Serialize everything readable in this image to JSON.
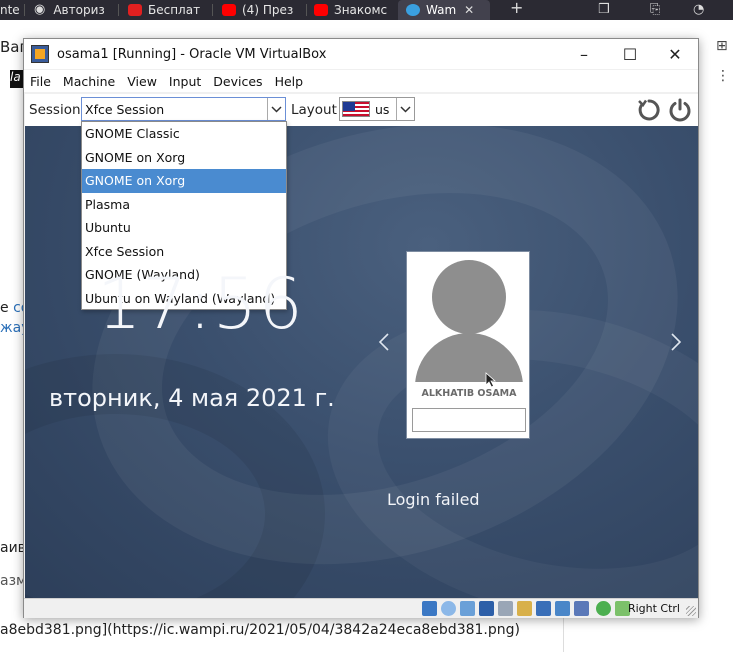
{
  "browser": {
    "tabs": [
      {
        "label": "nte",
        "icon": "page-icon",
        "color": "#777777"
      },
      {
        "label": "Авториз",
        "icon": "wifi-icon",
        "color": "#cccccc"
      },
      {
        "label": "Бесплат",
        "icon": "app-icon",
        "color": "#e02020"
      },
      {
        "label": "(4) През",
        "icon": "youtube-icon",
        "color": "#ff0000"
      },
      {
        "label": "Знакомс",
        "icon": "youtube-icon",
        "color": "#ff0000"
      },
      {
        "label": "Wam",
        "icon": "wampi-icon",
        "color": "#3aa0e0"
      }
    ],
    "new_tab": "+",
    "page_left_text": [
      "Ваг",
      "la",
      "e",
      "жау",
      "аив",
      "азм"
    ],
    "page_link_text": "со",
    "bottom_text": "a8ebd381.png](https://ic.wampi.ru/2021/05/04/3842a24eca8ebd381.png)"
  },
  "vbox": {
    "title": "osama1 [Running] - Oracle VM VirtualBox",
    "menu": [
      "File",
      "Machine",
      "View",
      "Input",
      "Devices",
      "Help"
    ],
    "host_key": "Right Ctrl",
    "status_icons": [
      "disk-icon",
      "optical-icon",
      "audio-icon",
      "network-icon",
      "usb-icon",
      "shared-folder-icon",
      "display-icon",
      "recording-icon",
      "vm-icon",
      "mouse-integration-icon",
      "keyboard-icon"
    ]
  },
  "login": {
    "session_label": "Session",
    "session_value": "Xfce Session",
    "layout_label": "Layout",
    "layout_value": "us",
    "session_options": [
      "GNOME Classic",
      "GNOME on Xorg",
      "GNOME on Xorg",
      "Plasma",
      "Ubuntu",
      "Xfce Session",
      "GNOME (Wayland)",
      "Ubuntu on Wayland (Wayland)"
    ],
    "selected_option_index": 2,
    "time": "17:56",
    "date": "вторник, 4 мая 2021 г.",
    "user_name": "ALKHATIB OSAMA",
    "message": "Login failed"
  },
  "colors": {
    "screen_bg": "#3a4f6d",
    "selection": "#4a8bd0",
    "titlebar": "#ffffff"
  }
}
